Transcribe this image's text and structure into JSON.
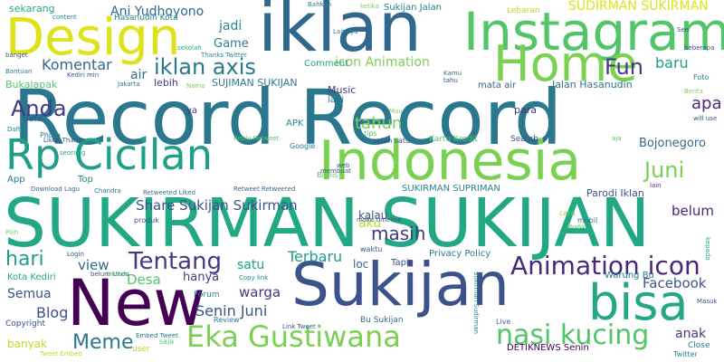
{
  "cloud": {
    "colors": {
      "yellow": "#dde318",
      "yellowgreen": "#b5de2b",
      "lightgreen": "#7ad151",
      "green": "#52c569",
      "teal": "#22a884",
      "tealdark": "#1f9e89",
      "cyan": "#25848e",
      "blue": "#2a788e",
      "steel": "#31688e",
      "slate": "#3b528b",
      "indigo": "#443983",
      "purple": "#482878",
      "deep": "#440154"
    },
    "words": [
      "Record Record",
      "SUKIRMAN SUKIJAN",
      "iklan",
      "Instagram",
      "Design",
      "Home",
      "Indonesia",
      "Rp Cicilan",
      "Sukijan",
      "New",
      "bisa",
      "Eka Gustiwana",
      "nasi kucing",
      "Animation icon",
      "Tentang",
      "iklan axis",
      "Anda",
      "Fun",
      "Juni",
      "Meme",
      "SUDIRMAN SUKIRMAN",
      "Ani Yudhoyono",
      "Komentar",
      "hari",
      "apa",
      "baru",
      "Share Sukijan Sukirman",
      "jadi",
      "masih",
      "Facebook",
      "view",
      "Desa",
      "Blog",
      "Terbaru",
      "tahun",
      "Senin Juni",
      "warga",
      "belum",
      "icon Animation",
      "Bojonegoro",
      "Game",
      "air",
      "aku",
      "hanya",
      "satu",
      "Semua",
      "anak",
      "kalau",
      "Parodi Iklan",
      "SUJIMAN SUKIJAN",
      "Music",
      "Bukalapak",
      "lebih",
      "para",
      "sekarang",
      "Hasanudin Kota",
      "Sukijan Jalan",
      "SUKIRMAN SUPRIMAN",
      "Jalan Hasanudin",
      "mata air",
      "banyak",
      "lagi",
      "APK",
      "Top",
      "loc",
      "Tapi",
      "Comment",
      "Lebaran",
      "Kota Kediri",
      "Privacy Policy",
      "Warung Bu",
      "DETIKNEWS Senin",
      "Bu Sukijan",
      "Forum",
      "Review",
      "Copyright",
      "Close",
      "Live",
      "Twitter",
      "data",
      "Photo",
      "Google",
      "Bisnis",
      "Search",
      "Kartu Kredit",
      "salah satu",
      "Reply Retweet",
      "Retweet Retweeted",
      "make timeline",
      "Download Lagu",
      "App",
      "Liked Thanks",
      "Foto",
      "seorang",
      "Daftar",
      "web",
      "cara",
      "produk",
      "mobil",
      "Mudik",
      "waktu",
      "Login",
      "content",
      "Bahkan",
      "sekolah",
      "Thanks Twitter",
      "Jakarta",
      "Nama",
      "ya",
      "tips",
      "Mau",
      "ketika",
      "Lainnya",
      "Kamu",
      "tahu",
      "lain",
      "Berita",
      "Masuk",
      "banget",
      "Bantuan",
      "beberapa",
      "will use",
      "Kediri min",
      "Pilih",
      "Copy link",
      "Embed Tweet",
      "Tweet Embed",
      "user",
      "saja",
      "Link Tweet",
      "Chandra",
      "Sukirman Sudirman",
      "kepada",
      "membuat",
      "Retweeted Liked",
      "belum Undo",
      "See",
      "aja",
      "Unduh"
    ]
  }
}
